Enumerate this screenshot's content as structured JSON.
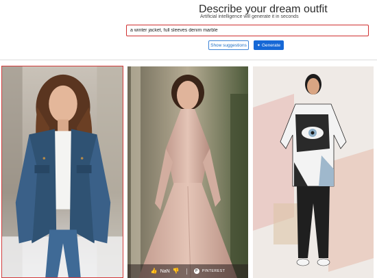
{
  "header": {
    "title": "Describe your dream outfit",
    "subtitle": "Artificial intelligence will generate it in seconds"
  },
  "prompt": {
    "value": "a winter jacket, full sleeves denim marble"
  },
  "buttons": {
    "suggestions_label": "Show suggestions",
    "generate_label": "Generate",
    "generate_icon": "sparkle-icon"
  },
  "results": {
    "cards": [
      {
        "subject": "woman in denim jacket",
        "selected": true
      },
      {
        "subject": "woman in blush satin gown",
        "selected": false,
        "overlay": {
          "likes": "NaN",
          "share_label": "PINTEREST"
        }
      },
      {
        "subject": "woman in graphic print tunic",
        "selected": false
      }
    ]
  },
  "colors": {
    "accent": "#1668d6",
    "selection": "#d23a3a"
  }
}
